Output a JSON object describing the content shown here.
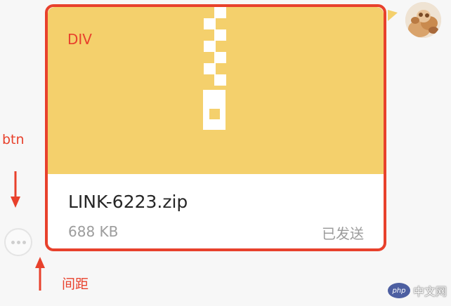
{
  "file_card": {
    "file_name": "LINK-6223.zip",
    "file_size": "688 KB",
    "status": "已发送",
    "header_color": "#f4d06c"
  },
  "annotations": {
    "div_label": "DIV",
    "btn_label": "btn",
    "gap_label": "间距",
    "color": "#e8412c"
  },
  "more_button": {
    "icon": "ellipsis-icon"
  },
  "avatar": {
    "icon": "user-avatar"
  },
  "watermark": {
    "logo_text": "php",
    "text": "中文网"
  }
}
